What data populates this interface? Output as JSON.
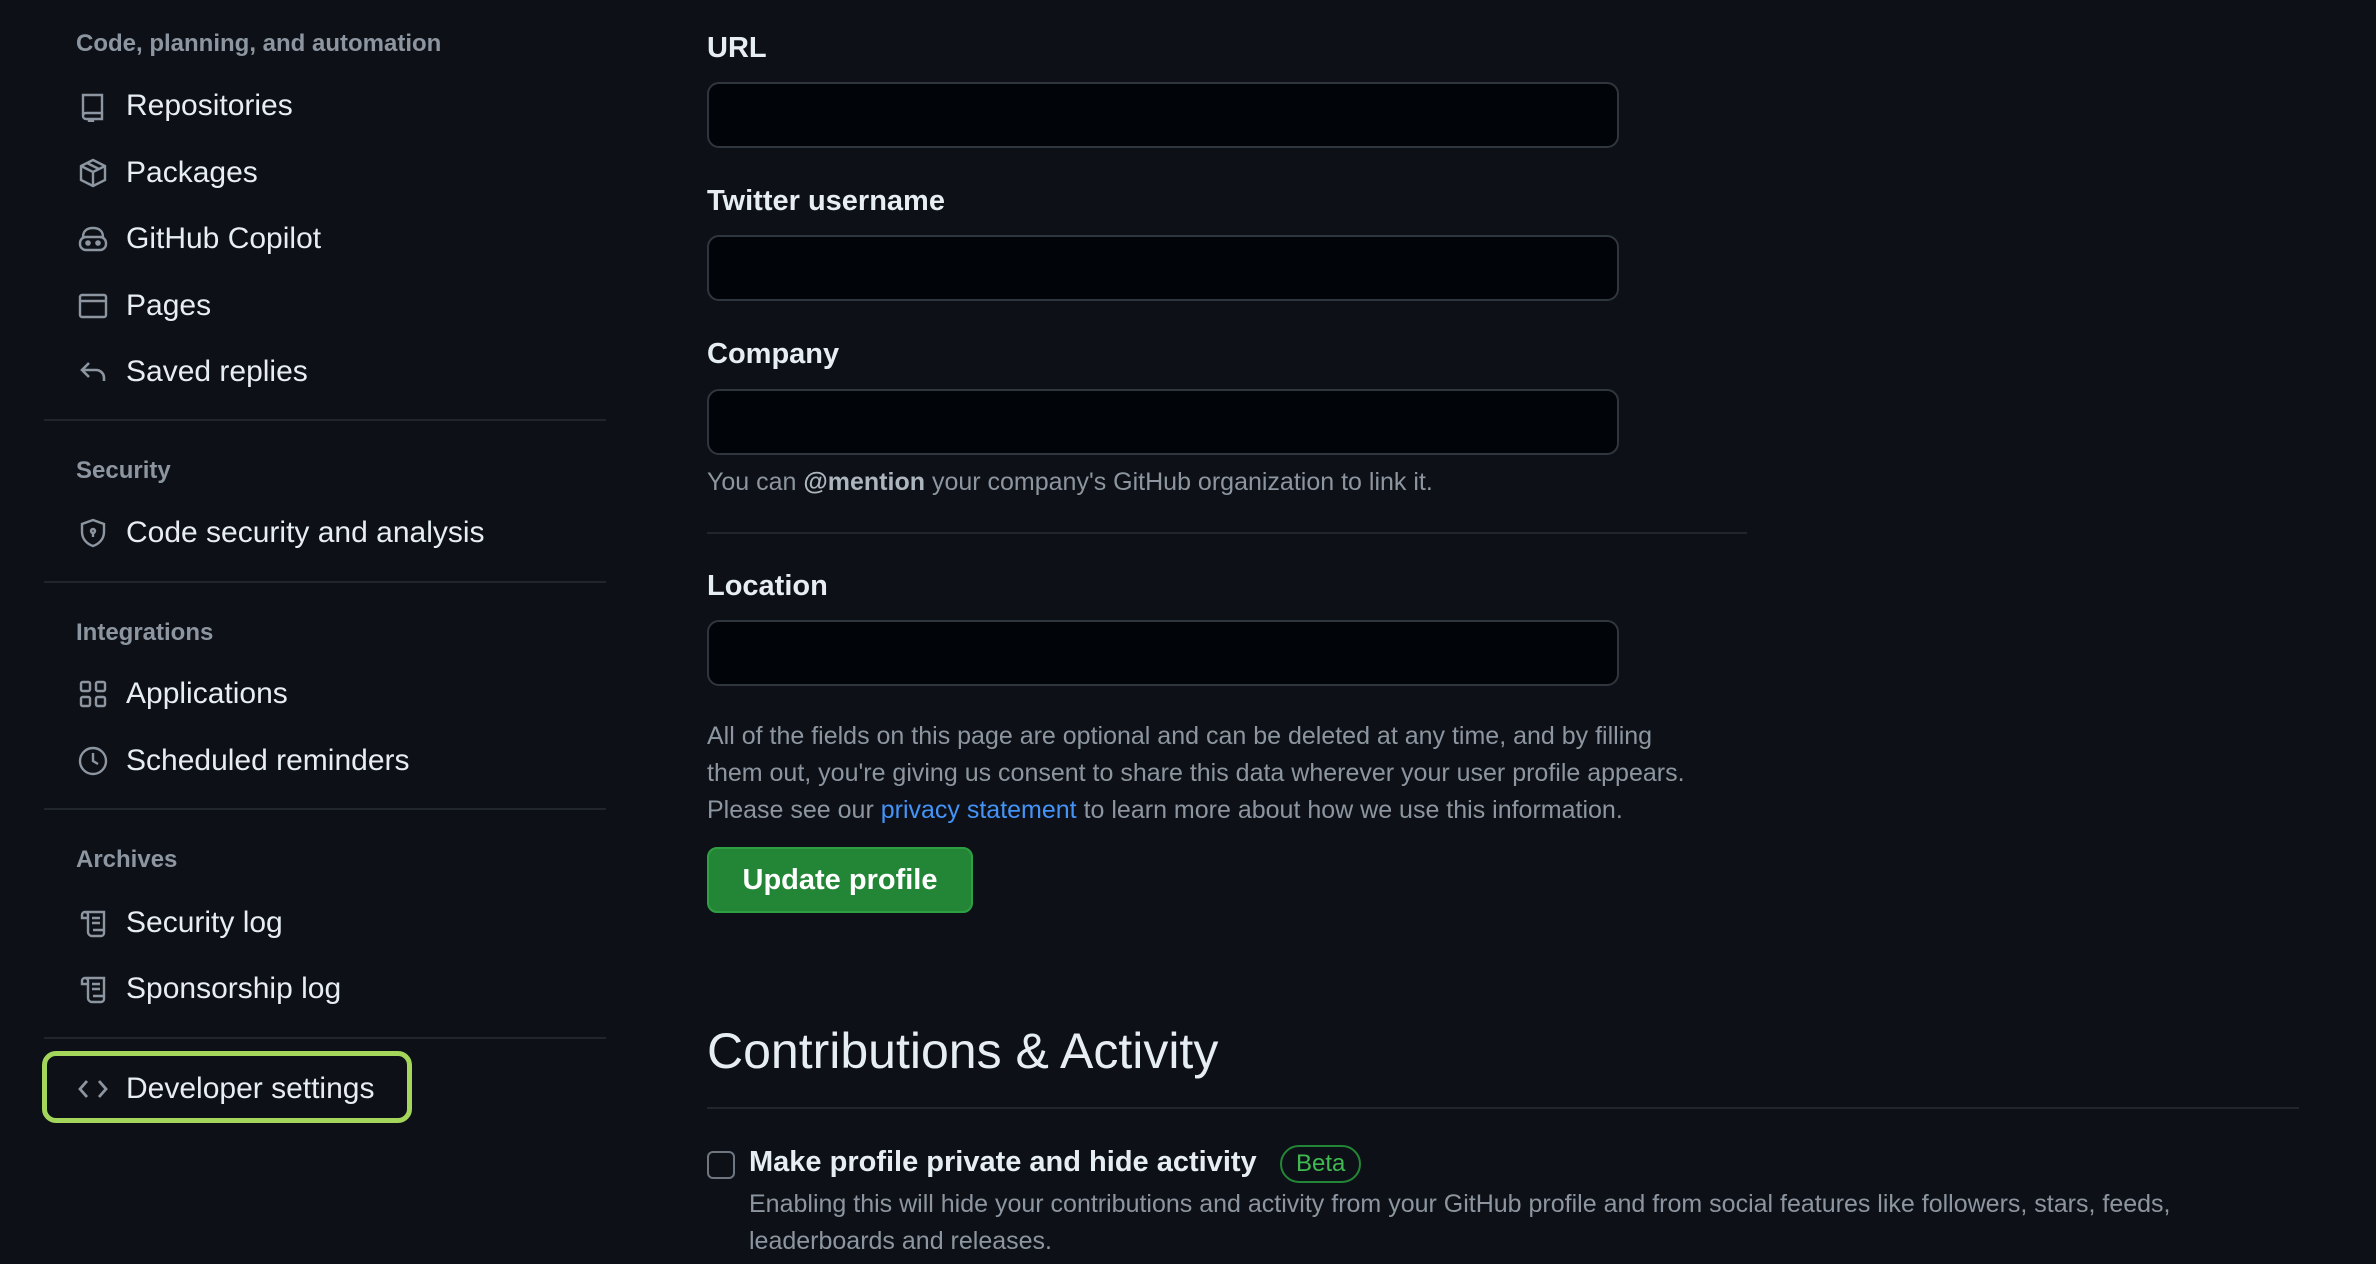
{
  "sidebar": {
    "groups": [
      {
        "heading": "Code, planning, and automation",
        "items": [
          {
            "label": "Repositories",
            "icon": "repo-icon"
          },
          {
            "label": "Packages",
            "icon": "package-icon"
          },
          {
            "label": "GitHub Copilot",
            "icon": "copilot-icon"
          },
          {
            "label": "Pages",
            "icon": "browser-icon"
          },
          {
            "label": "Saved replies",
            "icon": "reply-icon"
          }
        ]
      },
      {
        "heading": "Security",
        "items": [
          {
            "label": "Code security and analysis",
            "icon": "shield-lock-icon"
          }
        ]
      },
      {
        "heading": "Integrations",
        "items": [
          {
            "label": "Applications",
            "icon": "apps-icon"
          },
          {
            "label": "Scheduled reminders",
            "icon": "clock-icon"
          }
        ]
      },
      {
        "heading": "Archives",
        "items": [
          {
            "label": "Security log",
            "icon": "log-icon"
          },
          {
            "label": "Sponsorship log",
            "icon": "log-icon"
          }
        ]
      }
    ],
    "developer_settings": {
      "label": "Developer settings",
      "icon": "code-icon"
    }
  },
  "form": {
    "url": {
      "label": "URL",
      "value": ""
    },
    "twitter": {
      "label": "Twitter username",
      "value": ""
    },
    "company": {
      "label": "Company",
      "value": "",
      "note_before": "You can ",
      "note_mention": "@mention",
      "note_after": " your company's GitHub organization to link it."
    },
    "location": {
      "label": "Location",
      "value": ""
    },
    "disclaimer": {
      "line1": "All of the fields on this page are optional and can be deleted at any time, and by filling",
      "line2": "them out, you're giving us consent to share this data wherever your user profile appears.",
      "line3_before": "Please see our ",
      "line3_link": "privacy statement",
      "line3_after": " to learn more about how we use this information."
    },
    "update_button": "Update profile"
  },
  "contributions": {
    "title": "Contributions & Activity",
    "private_option": {
      "label": "Make profile private and hide activity",
      "badge": "Beta",
      "checked": false,
      "description": "Enabling this will hide your contributions and activity from your GitHub profile and from social features like followers, stars, feeds, leaderboards and releases."
    }
  },
  "colors": {
    "background": "#0d1117",
    "accent_green": "#238636",
    "link_blue": "#4493f8",
    "highlight": "#a3d65b"
  }
}
